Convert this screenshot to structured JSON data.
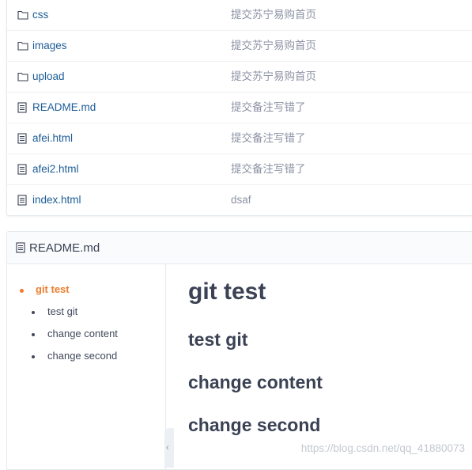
{
  "files": [
    {
      "name": "css",
      "message": "提交苏宁易购首页",
      "type": "folder"
    },
    {
      "name": "images",
      "message": "提交苏宁易购首页",
      "type": "folder"
    },
    {
      "name": "upload",
      "message": "提交苏宁易购首页",
      "type": "folder"
    },
    {
      "name": "README.md",
      "message": "提交备注写错了",
      "type": "file"
    },
    {
      "name": "afei.html",
      "message": "提交备注写错了",
      "type": "file"
    },
    {
      "name": "afei2.html",
      "message": "提交备注写错了",
      "type": "file"
    },
    {
      "name": "index.html",
      "message": "dsaf",
      "type": "file"
    }
  ],
  "readme": {
    "title": "README.md",
    "toc": [
      "git test",
      "test git",
      "change content",
      "change second"
    ],
    "headings": {
      "h1": "git test",
      "h2": [
        "test git",
        "change content",
        "change second"
      ]
    }
  },
  "watermark": "https://blog.csdn.net/qq_41880073",
  "colors": {
    "link": "#1d5c96",
    "accent": "#ee7d2d",
    "muted": "#8c92a4"
  }
}
